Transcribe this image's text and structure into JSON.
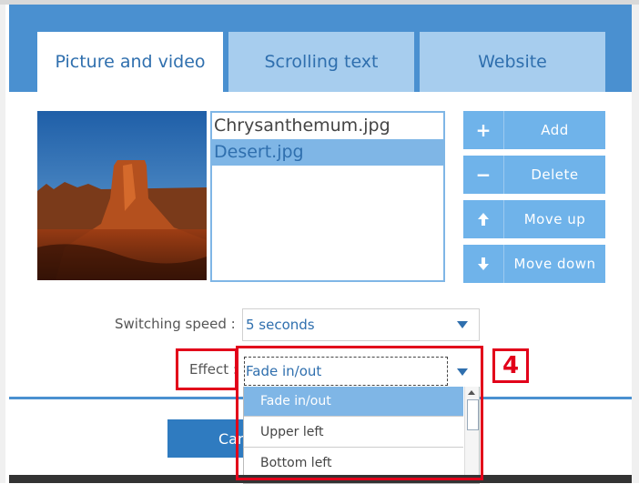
{
  "tabs": [
    {
      "label": "Picture and video",
      "active": true
    },
    {
      "label": "Scrolling text",
      "active": false
    },
    {
      "label": "Website",
      "active": false
    }
  ],
  "files": [
    {
      "name": "Chrysanthemum.jpg",
      "selected": false
    },
    {
      "name": "Desert.jpg",
      "selected": true
    }
  ],
  "actions": [
    {
      "icon": "plus-icon",
      "label": "Add"
    },
    {
      "icon": "minus-icon",
      "label": "Delete"
    },
    {
      "icon": "arrow-up-icon",
      "label": "Move up"
    },
    {
      "icon": "arrow-down-icon",
      "label": "Move down"
    }
  ],
  "switching_speed": {
    "label": "Switching speed :",
    "value": "5  seconds"
  },
  "effect": {
    "label": "Effect :",
    "value": "Fade in/out",
    "options": [
      "Fade in/out",
      "Upper left",
      "Bottom left"
    ]
  },
  "cancel_label": "Can",
  "annotation": {
    "step": "4"
  },
  "colors": {
    "accent": "#4a90d0",
    "selection": "#7fb6e6",
    "highlight": "#e2001a"
  }
}
